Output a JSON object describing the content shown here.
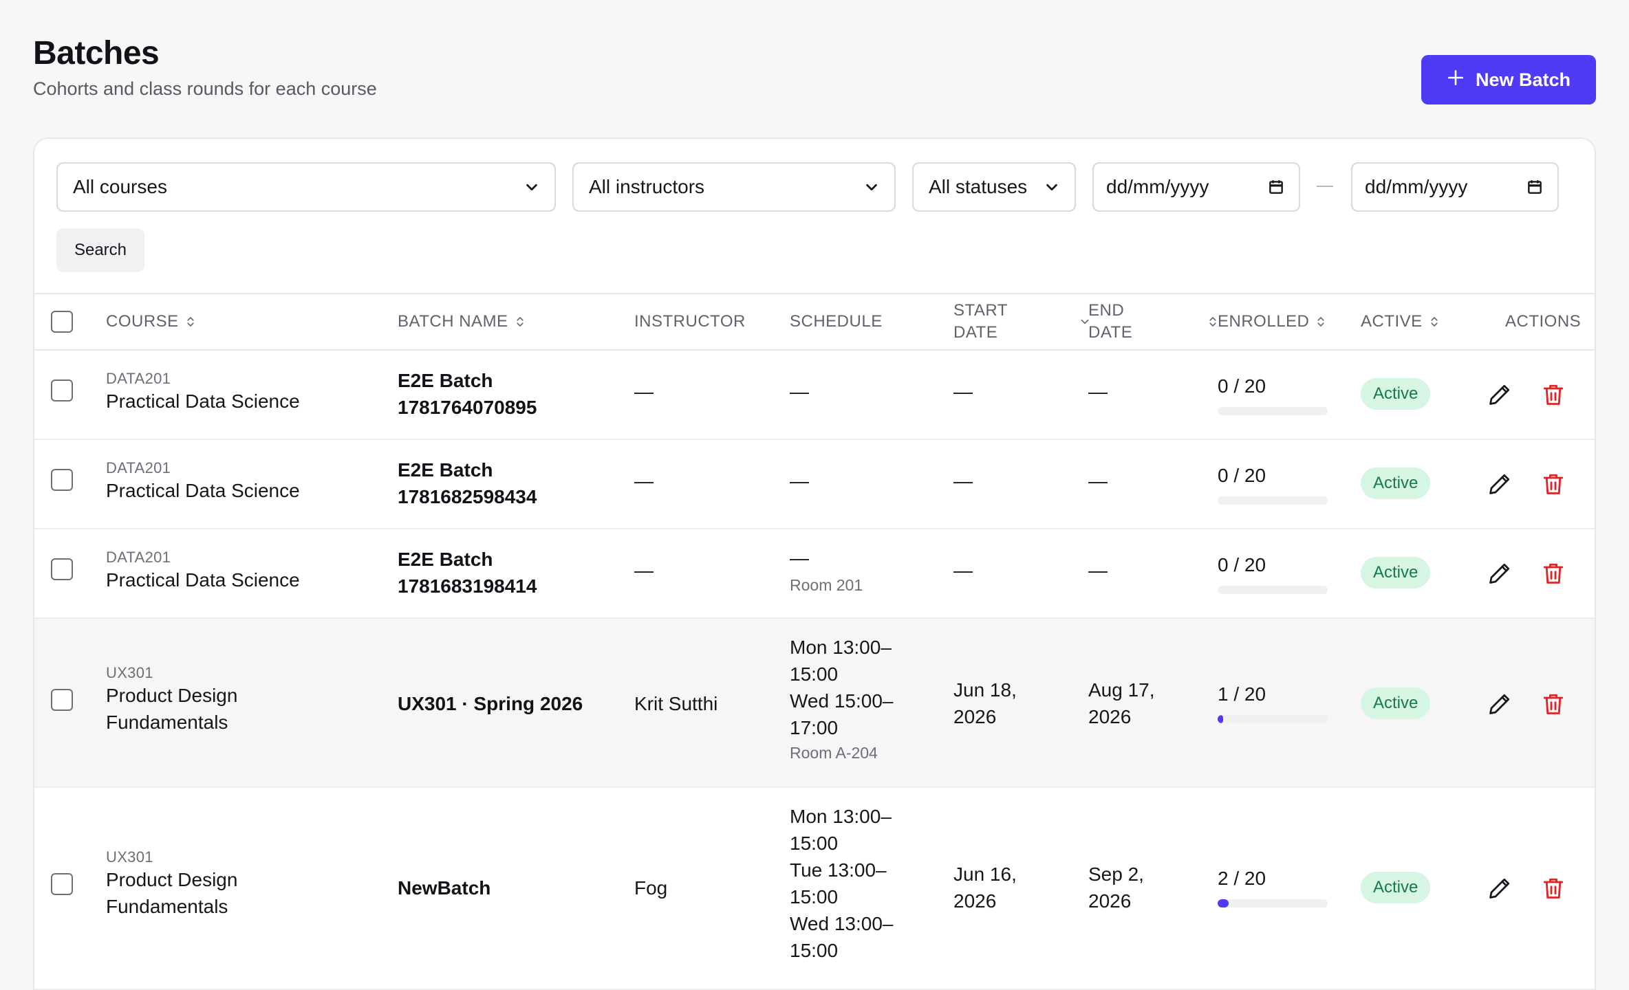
{
  "header": {
    "title": "Batches",
    "subtitle": "Cohorts and class rounds for each course",
    "new_batch_label": "New Batch"
  },
  "filters": {
    "course": "All courses",
    "instructor": "All instructors",
    "status": "All statuses",
    "date_from_placeholder": "dd/mm/yyyy",
    "date_to_placeholder": "dd/mm/yyyy",
    "search_label": "Search"
  },
  "table": {
    "columns": {
      "course": "COURSE",
      "batch_name": "BATCH NAME",
      "instructor": "INSTRUCTOR",
      "schedule": "SCHEDULE",
      "start_date_1": "START",
      "start_date_2": "DATE",
      "end_date_1": "END",
      "end_date_2": "DATE",
      "enrolled": "ENROLLED",
      "active": "ACTIVE",
      "actions": "ACTIONS"
    },
    "rows": [
      {
        "course_code": "DATA201",
        "course_name": "Practical Data Science",
        "batch_line1": "E2E Batch",
        "batch_line2": "1781764070895",
        "instructor": "—",
        "schedule_line1": "—",
        "start_date": "—",
        "end_date": "—",
        "enrolled": "0 / 20",
        "enrolled_fraction": 0,
        "status": "Active"
      },
      {
        "course_code": "DATA201",
        "course_name": "Practical Data Science",
        "batch_line1": "E2E Batch",
        "batch_line2": "1781682598434",
        "instructor": "—",
        "schedule_line1": "—",
        "start_date": "—",
        "end_date": "—",
        "enrolled": "0 / 20",
        "enrolled_fraction": 0,
        "status": "Active"
      },
      {
        "course_code": "DATA201",
        "course_name": "Practical Data Science",
        "batch_line1": "E2E Batch",
        "batch_line2": "1781683198414",
        "instructor": "—",
        "schedule_line1": "—",
        "room": "Room 201",
        "start_date": "—",
        "end_date": "—",
        "enrolled": "0 / 20",
        "enrolled_fraction": 0,
        "status": "Active"
      },
      {
        "course_code": "UX301",
        "course_name_1": "Product Design",
        "course_name_2": "Fundamentals",
        "batch_line1": "UX301 · Spring 2026",
        "instructor": "Krit Sutthi",
        "schedule_1": "Mon 13:00–",
        "schedule_2": "15:00",
        "schedule_3": "Wed 15:00–",
        "schedule_4": "17:00",
        "room": "Room A-204",
        "start_1": "Jun 18,",
        "start_2": "2026",
        "end_1": "Aug 17,",
        "end_2": "2026",
        "enrolled": "1 / 20",
        "enrolled_fraction": 0.05,
        "status": "Active"
      },
      {
        "course_code": "UX301",
        "course_name_1": "Product Design",
        "course_name_2": "Fundamentals",
        "batch_line1": "NewBatch",
        "instructor": "Fog",
        "schedule_1": "Mon 13:00–",
        "schedule_2": "15:00",
        "schedule_3": "Tue 13:00–",
        "schedule_4": "15:00",
        "schedule_5": "Wed 13:00–",
        "schedule_6": "15:00",
        "start_1": "Jun 16,",
        "start_2": "2026",
        "end_1": "Sep 2,",
        "end_2": "2026",
        "enrolled": "2 / 20",
        "enrolled_fraction": 0.1,
        "status": "Active"
      }
    ]
  },
  "colors": {
    "accent": "#4f3bf6",
    "badge_bg": "#d6f5e3",
    "badge_text": "#167a45",
    "delete": "#e02424"
  },
  "icons": [
    "plus-icon",
    "chevron-down-icon",
    "calendar-icon",
    "sort-icon",
    "pencil-icon",
    "trash-icon"
  ]
}
